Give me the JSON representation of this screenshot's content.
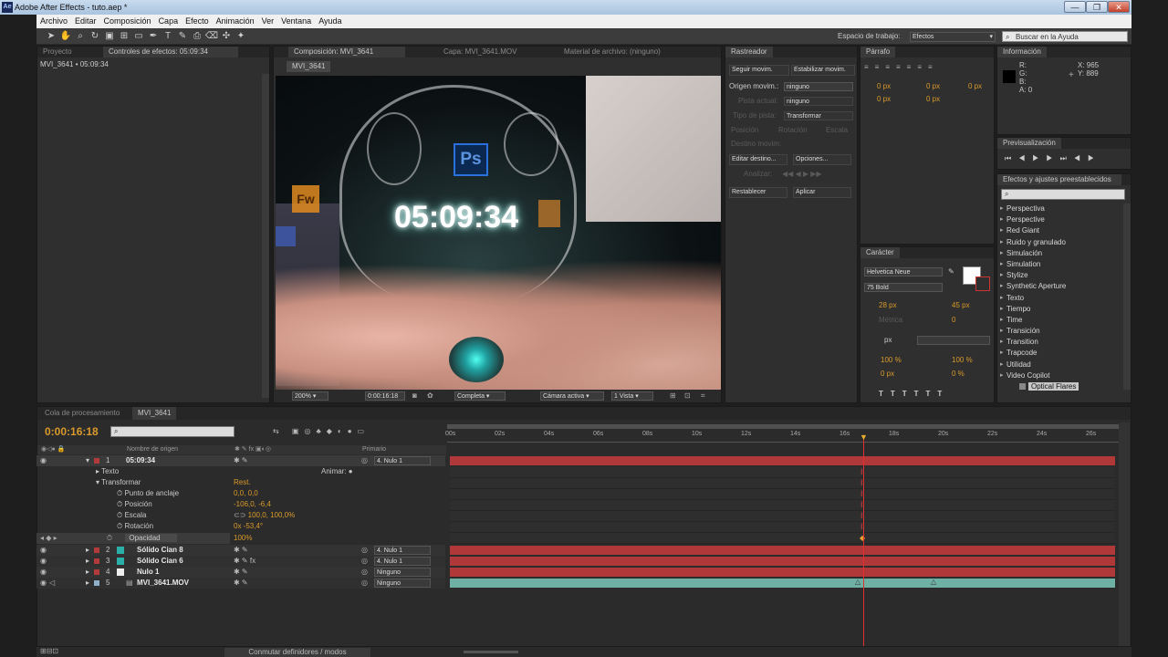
{
  "app": {
    "title": "Adobe After Effects - tuto.aep *",
    "min": "—",
    "max": "❐",
    "close": "✕"
  },
  "menu": [
    "Archivo",
    "Editar",
    "Composición",
    "Capa",
    "Efecto",
    "Animación",
    "Ver",
    "Ventana",
    "Ayuda"
  ],
  "toolbar": {
    "workspace_label": "Espacio de trabajo:",
    "workspace_value": "Efectos",
    "search_placeholder": "Buscar en la Ayuda"
  },
  "project_panel": {
    "tab1": "Proyecto",
    "tab2": "Controles de efectos: 05:09:34",
    "subtitle": "MVI_3641 • 05:09:34"
  },
  "comp_panel": {
    "tab": "Composición: MVI_3641",
    "tab2": "Capa: MVI_3641.MOV",
    "tab3": "Material de archivo: (ninguno)",
    "subtab": "MVI_3641",
    "overlay_time": "05:09:34",
    "logo_ps": "Ps",
    "logo_fw": "Fw",
    "zoom": "200%",
    "timecode": "0:00:16:18",
    "resolution": "Completa",
    "camera": "Cámara activa",
    "views": "1 Vista"
  },
  "tracker": {
    "tab": "Rastreador",
    "btn1": "Seguir movim.",
    "btn2": "Estabilizar movim.",
    "origin_label": "Origen movim.:",
    "origin_value": "ninguno",
    "track_label": "Pista actual:",
    "track_value": "ninguno",
    "type_label": "Tipo de pista:",
    "type_value": "Transformar",
    "opt1": "Posición",
    "opt2": "Rotación",
    "opt3": "Escala",
    "target_label": "Destino movim:",
    "edit_target": "Editar destino...",
    "options": "Opciones...",
    "analyze": "Analizar:",
    "reset": "Restablecer",
    "apply": "Aplicar"
  },
  "paragraph": {
    "tab": "Párrafo",
    "v1": "0 px",
    "v2": "0 px",
    "v3": "0 px",
    "v4": "0 px",
    "v5": "0 px"
  },
  "info": {
    "tab": "Información",
    "r": "R:",
    "g": "G:",
    "b": "B:",
    "a": "A: 0",
    "x": "X: 965",
    "y": "Y: 889"
  },
  "preview": {
    "tab": "Previsualización"
  },
  "effects": {
    "tab": "Efectos y ajustes preestablecidos",
    "items": [
      "Perspectiva",
      "Perspective",
      "Red Giant",
      "Ruido y granulado",
      "Simulación",
      "Simulation",
      "Stylize",
      "Synthetic Aperture",
      "Texto",
      "Tiempo",
      "Time",
      "Transición",
      "Transition",
      "Trapcode",
      "Utilidad",
      "Video Copilot"
    ],
    "selected": "Optical Flares"
  },
  "character": {
    "tab": "Carácter",
    "font": "Helvetica Neue",
    "style": "75 Bold",
    "size": "28 px",
    "leading": "45 px",
    "kerning": "Métrica",
    "tracking": "0",
    "stroke": "px",
    "scale_v": "100 %",
    "scale_h": "100 %",
    "baseline": "0 px",
    "tsume": "0 %"
  },
  "timeline": {
    "tab1": "Cola de procesamiento",
    "tab2": "MVI_3641",
    "time": "0:00:16:18",
    "col_name": "Nombre de origen",
    "col_parent": "Primario",
    "ticks": [
      "00s",
      "02s",
      "04s",
      "06s",
      "08s",
      "10s",
      "12s",
      "14s",
      "16s",
      "18s",
      "20s",
      "22s",
      "24s",
      "26s"
    ],
    "footer": "Conmutar definidores / modos",
    "layers": [
      {
        "num": "1",
        "name": "05:09:34",
        "parent": "4. Nulo 1",
        "color": "#b23a3a"
      },
      {
        "num": "2",
        "name": "Sólido Cian 8",
        "parent": "4. Nulo 1",
        "color": "#2ab0a8"
      },
      {
        "num": "3",
        "name": "Sólido Cian 6",
        "parent": "4. Nulo 1",
        "color": "#2ab0a8"
      },
      {
        "num": "4",
        "name": "Nulo 1",
        "parent": "Ninguno",
        "color": "#eeeeee"
      },
      {
        "num": "5",
        "name": "MVI_3641.MOV",
        "parent": "Ninguno",
        "color": "#9ab"
      }
    ],
    "props": {
      "text": "Texto",
      "animate": "Animar:",
      "transform": "Transformar",
      "reset": "Rest.",
      "anchor": "Punto de anclaje",
      "anchor_v": "0,0, 0,0",
      "pos": "Posición",
      "pos_v": "-106,0, -6,4",
      "scale": "Escala",
      "scale_v": "100,0, 100,0%",
      "rot": "Rotación",
      "rot_v": "0x -53,4°",
      "opacity": "Opacidad",
      "opacity_v": "100%"
    }
  }
}
